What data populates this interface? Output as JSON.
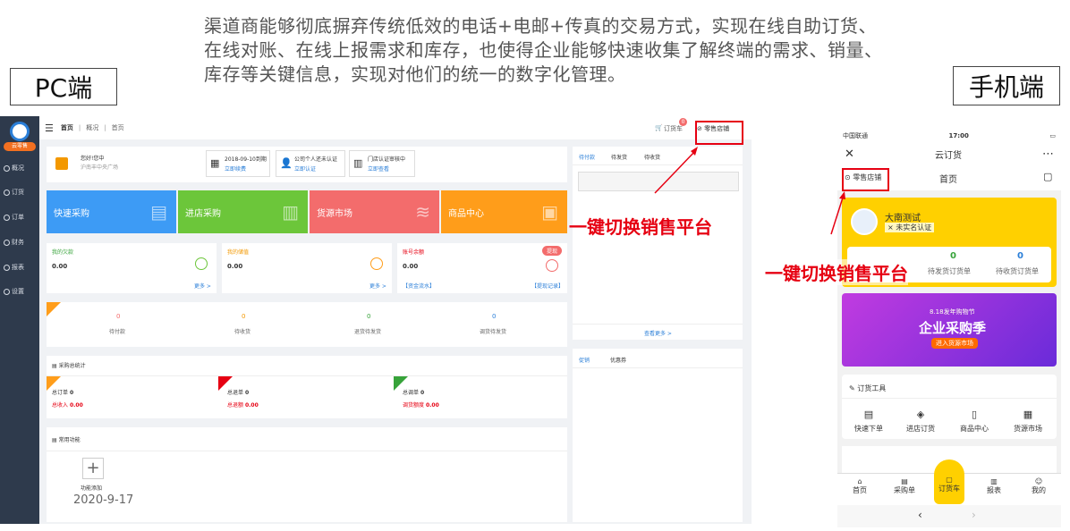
{
  "headline": "渠道商能够彻底摒弃传统低效的电话+电邮+传真的交易方式，实现在线自助订货、在线对账、在线上报需求和库存，也使得企业能够快速收集了解终端的需求、销量、库存等关键信息，实现对他们的统一的数字化管理。",
  "labels": {
    "pc": "PC端",
    "mobile": "手机端",
    "switch_pc": "一键切换销售平台",
    "switch_mobile": "一键切换销售平台"
  },
  "pc": {
    "logo_tag": "云零售",
    "sidebar": [
      "概况",
      "订货",
      "订单",
      "财务",
      "报表",
      "设置"
    ],
    "breadcrumb": [
      "首页",
      "概况",
      "首页"
    ],
    "cart_label": "订货车",
    "cart_badge": "0",
    "retail_button": "零售店铺",
    "greeting": "您好!您中",
    "address": "沪南丰中央广场",
    "info": [
      {
        "title": "2018-09-10到期",
        "link": "立即续费"
      },
      {
        "title": "公司个人还未认证",
        "link": "立即认证"
      },
      {
        "title": "门店认证审核中",
        "link": "立即查看"
      }
    ],
    "tiles": [
      "快速采购",
      "进店采购",
      "货源市场",
      "商品中心"
    ],
    "stats": [
      {
        "title": "我的欠款",
        "value": "0.00",
        "link": "更多 >"
      },
      {
        "title": "我的储值",
        "value": "0.00",
        "link": "更多 >"
      },
      {
        "title": "账号余额",
        "value": "0.00",
        "badge": "提现",
        "link1": "【资金流水】",
        "link2": "【提现记录】"
      }
    ],
    "orders": [
      {
        "count": "0",
        "label": "待付款"
      },
      {
        "count": "0",
        "label": "待收货"
      },
      {
        "count": "0",
        "label": "退货待发货"
      },
      {
        "count": "0",
        "label": "调货待发货"
      }
    ],
    "purchase_title": "采购总统计",
    "purchase": [
      {
        "l1": "总订单",
        "v1": "0",
        "l2": "总收入",
        "v2": "0.00"
      },
      {
        "l1": "总退单",
        "v1": "0",
        "l2": "总退额",
        "v2": "0.00"
      },
      {
        "l1": "总调单",
        "v1": "0",
        "l2": "调货额度",
        "v2": "0.00"
      }
    ],
    "common_title": "常用功能",
    "add_label": "功能添加",
    "date": "2020-9-17",
    "right_tabs": [
      "待付款",
      "待发货",
      "待收货"
    ],
    "view_more": "查看更多 >",
    "promo_tabs": [
      "促销",
      "优惠券"
    ]
  },
  "mobile": {
    "carrier": "中国联通",
    "time": "17:00",
    "title": "云订货",
    "retail": "零售店铺",
    "home": "首页",
    "user": "大南测试",
    "verify": "× 未实名认证",
    "counts": [
      {
        "v": "0",
        "l": "待发货订货单"
      },
      {
        "v": "0",
        "l": "待收货订货单"
      }
    ],
    "banner_small": "8.18发年购物节",
    "banner_big": "企业采购季",
    "banner_btn": "进入货源市场",
    "tools_title": "订货工具",
    "tools": [
      "快速下单",
      "进店订货",
      "商品中心",
      "货源市场"
    ],
    "tabs": [
      "首页",
      "采购单",
      "订货车",
      "报表",
      "我的"
    ]
  },
  "colors": {
    "blue": "#3d9bf5",
    "green": "#6cc63a",
    "red": "#f36c6c",
    "orange": "#ff9d1a",
    "accent": "#e60012",
    "yellow": "#ffd000"
  }
}
